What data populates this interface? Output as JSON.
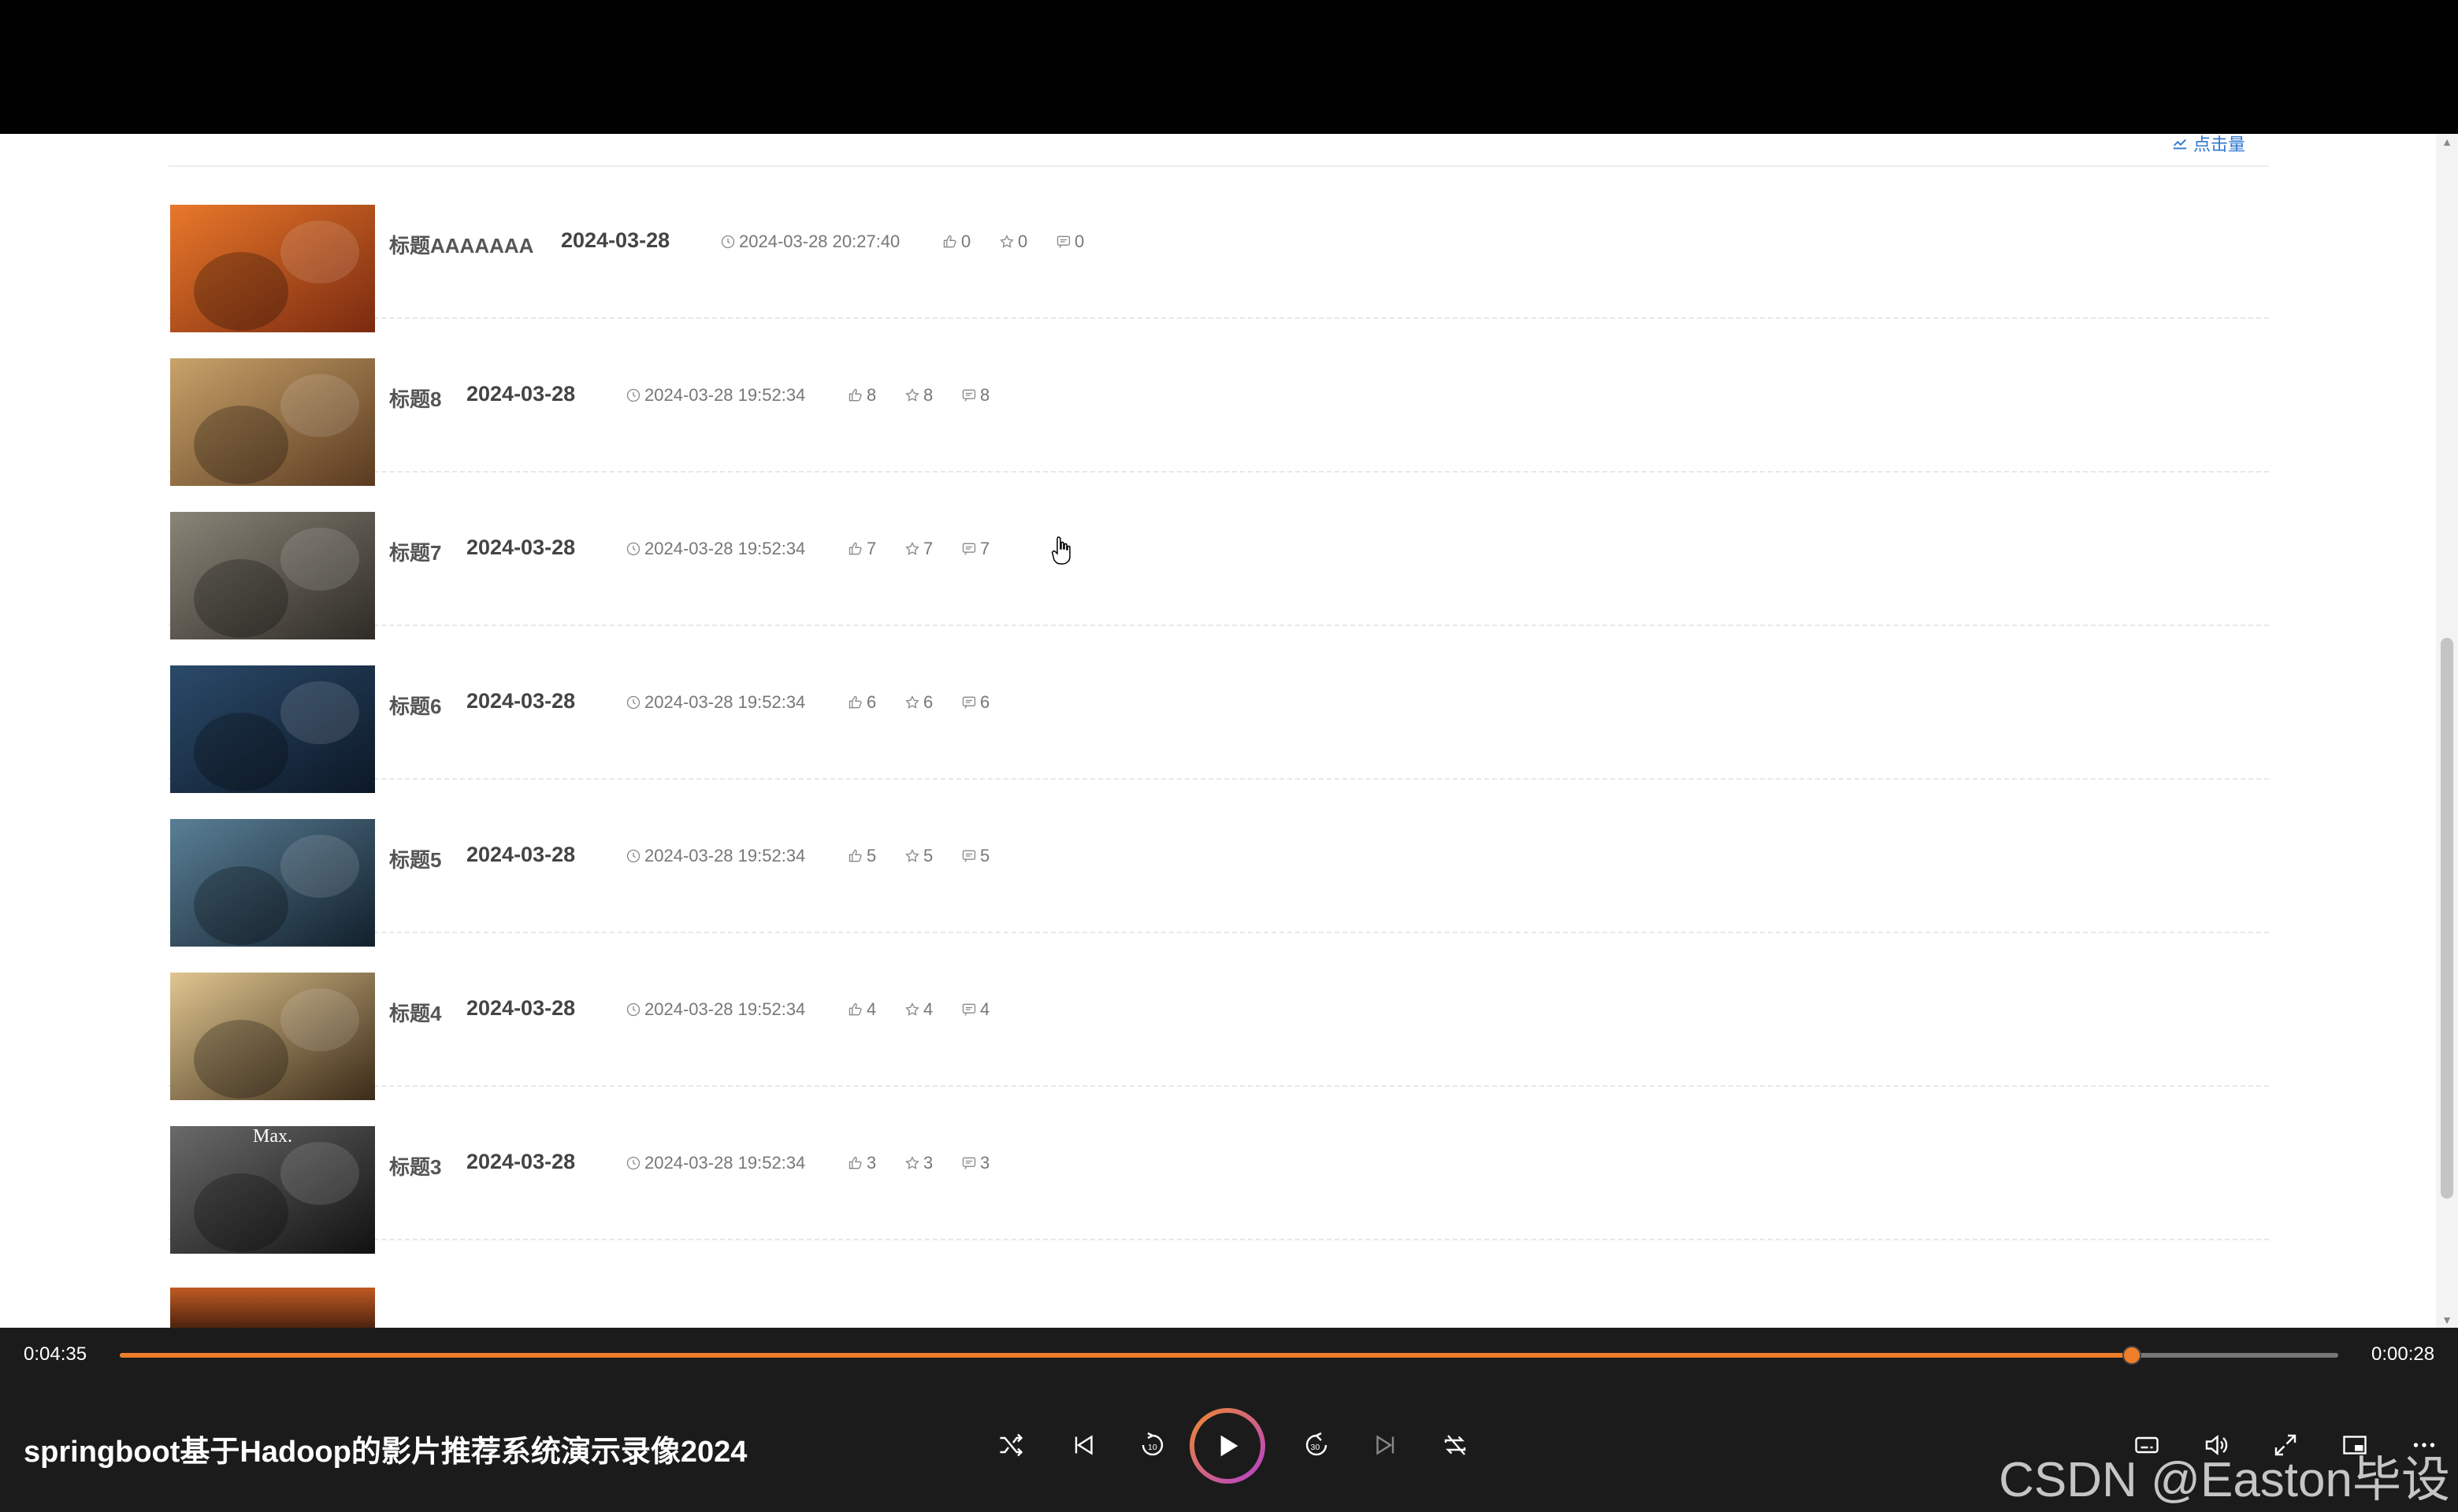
{
  "page": {
    "sort_label": "点击量",
    "rows": [
      {
        "title": "标题AAAAAAA",
        "date": "2024-03-28",
        "datetime": "2024-03-28 20:27:40",
        "likes": "0",
        "favorites": "0",
        "comments": "0",
        "thumb_colors": [
          "#e9782a",
          "#7a2a10"
        ]
      },
      {
        "title": "标题8",
        "date": "2024-03-28",
        "datetime": "2024-03-28 19:52:34",
        "likes": "8",
        "favorites": "8",
        "comments": "8",
        "thumb_colors": [
          "#c9a36a",
          "#5a3a20"
        ]
      },
      {
        "title": "标题7",
        "date": "2024-03-28",
        "datetime": "2024-03-28 19:52:34",
        "likes": "7",
        "favorites": "7",
        "comments": "7",
        "thumb_colors": [
          "#8a8578",
          "#2e2b26"
        ]
      },
      {
        "title": "标题6",
        "date": "2024-03-28",
        "datetime": "2024-03-28 19:52:34",
        "likes": "6",
        "favorites": "6",
        "comments": "6",
        "thumb_colors": [
          "#2b4a6a",
          "#0c1826"
        ]
      },
      {
        "title": "标题5",
        "date": "2024-03-28",
        "datetime": "2024-03-28 19:52:34",
        "likes": "5",
        "favorites": "5",
        "comments": "5",
        "thumb_colors": [
          "#5a7f96",
          "#12202c"
        ]
      },
      {
        "title": "标题4",
        "date": "2024-03-28",
        "datetime": "2024-03-28 19:52:34",
        "likes": "4",
        "favorites": "4",
        "comments": "4",
        "thumb_colors": [
          "#e0c690",
          "#3a2a18"
        ]
      },
      {
        "title": "标题3",
        "date": "2024-03-28",
        "datetime": "2024-03-28 19:52:34",
        "likes": "3",
        "favorites": "3",
        "comments": "3",
        "thumb_colors": [
          "#6a6a6a",
          "#111111"
        ],
        "thumb_text": "Max."
      }
    ]
  },
  "player": {
    "elapsed": "0:04:35",
    "remaining": "0:00:28",
    "progress_fraction": 0.907,
    "title": "springboot基于Hadoop的影片推荐系统演示录像2024",
    "accent_color": "#ef7e2a",
    "controls": [
      "shuffle-icon",
      "previous-icon",
      "rewind-10-icon",
      "play-icon",
      "forward-30-icon",
      "next-icon",
      "repeat-icon",
      "subtitles-icon",
      "volume-icon",
      "fullscreen-icon",
      "miniplayer-icon",
      "more-icon"
    ]
  },
  "watermark": "CSDN @Easton毕设"
}
